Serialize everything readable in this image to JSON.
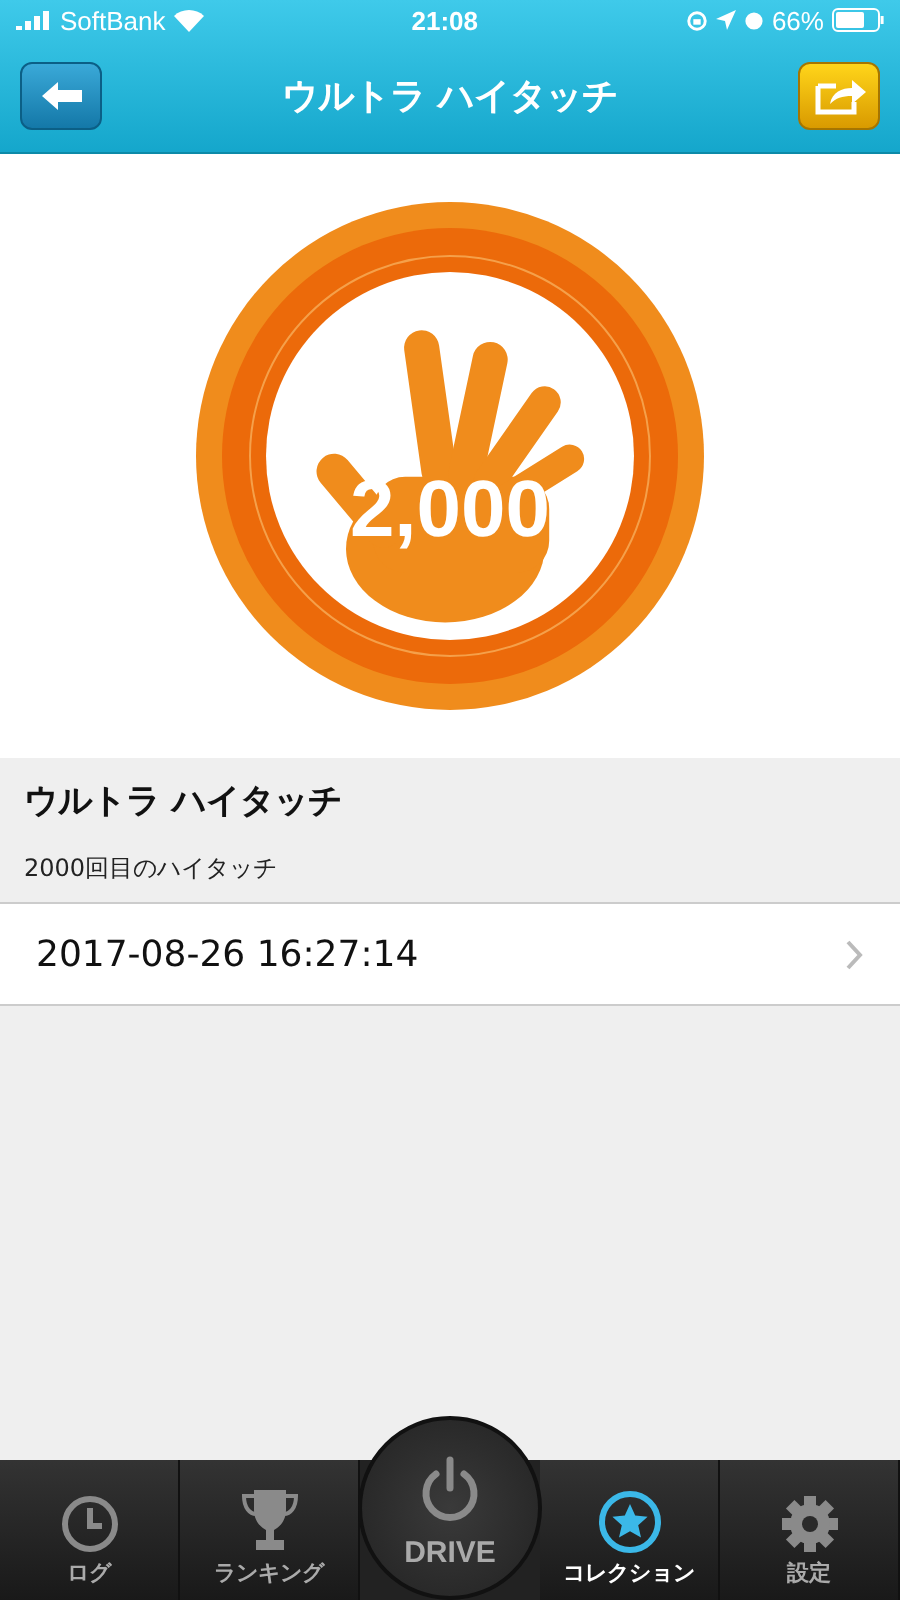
{
  "status_bar": {
    "carrier": "SoftBank",
    "time": "21:08",
    "battery": "66%"
  },
  "nav": {
    "title": "ウルトラ ハイタッチ"
  },
  "badge": {
    "number": "2,000"
  },
  "info": {
    "title": "ウルトラ ハイタッチ",
    "subtitle": "2000回目のハイタッチ"
  },
  "records": [
    {
      "datetime": "2017-08-26 16:27:14"
    }
  ],
  "tabs": [
    {
      "kind": "log",
      "label": "ログ",
      "selected": false
    },
    {
      "kind": "ranking",
      "label": "ランキング",
      "selected": false
    },
    {
      "kind": "drive",
      "label": "DRIVE",
      "selected": false
    },
    {
      "kind": "collection",
      "label": "コレクション",
      "selected": true
    },
    {
      "kind": "settings",
      "label": "設定",
      "selected": false
    }
  ]
}
